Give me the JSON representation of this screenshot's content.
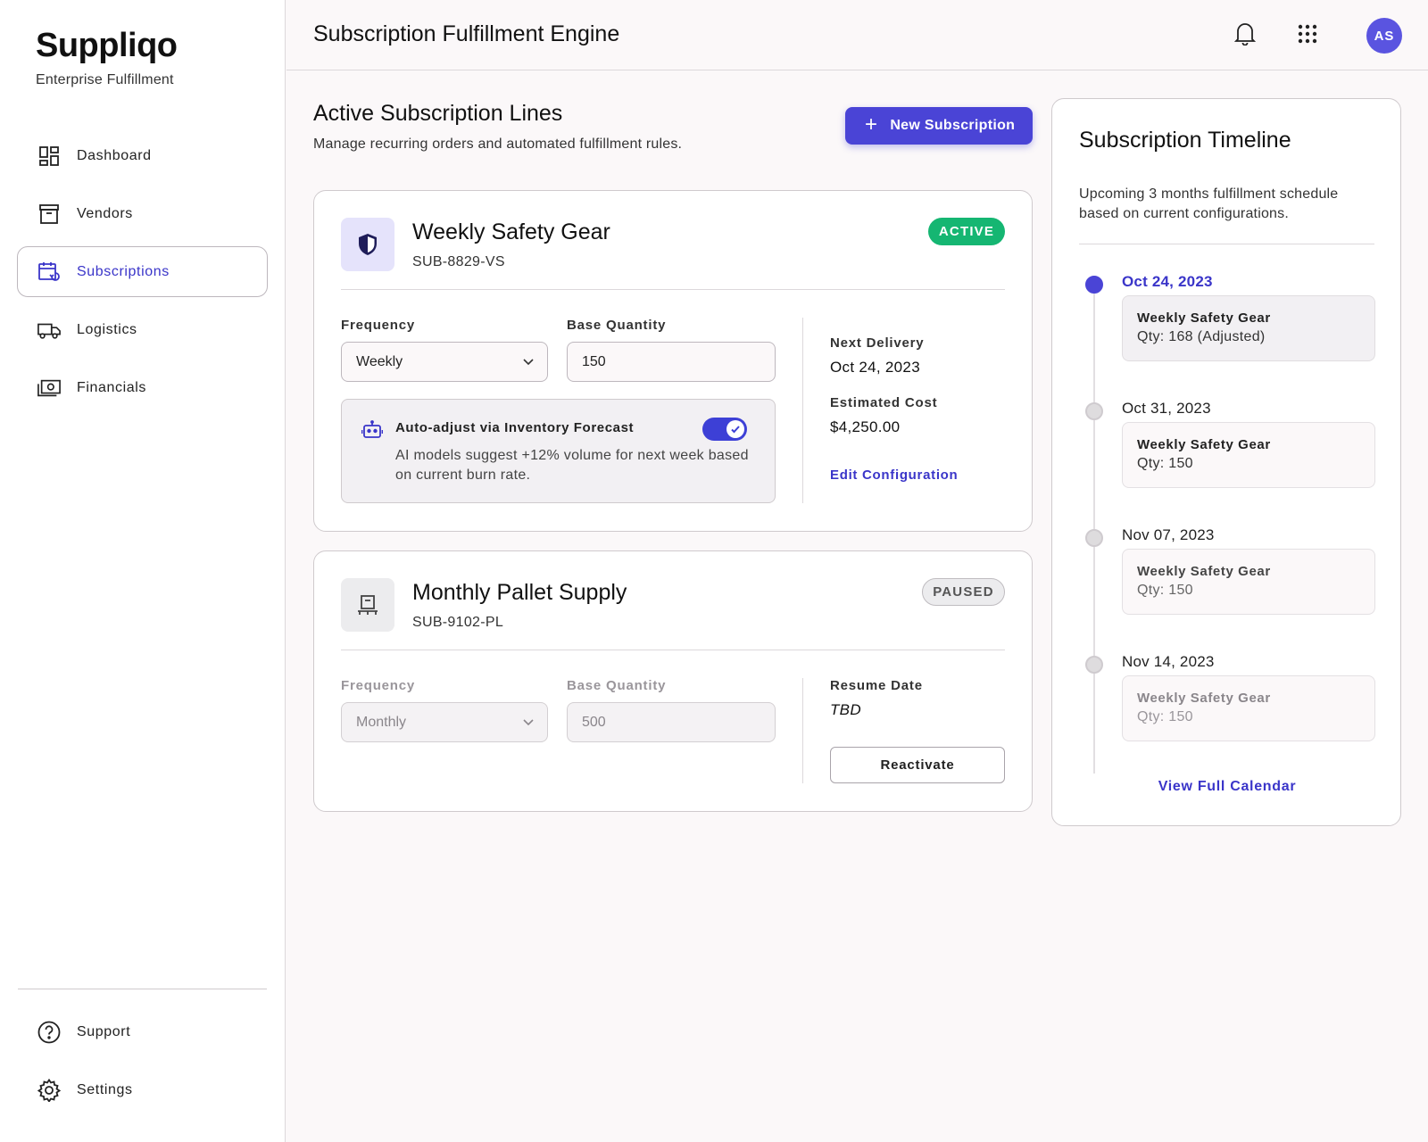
{
  "brand": {
    "name": "Suppliqo",
    "subtitle": "Enterprise Fulfillment"
  },
  "sidebar": {
    "items": [
      {
        "label": "Dashboard",
        "icon": "dashboard-icon"
      },
      {
        "label": "Vendors",
        "icon": "archive-icon"
      },
      {
        "label": "Subscriptions",
        "icon": "calendar-repeat-icon",
        "active": true
      },
      {
        "label": "Logistics",
        "icon": "truck-icon"
      },
      {
        "label": "Financials",
        "icon": "money-icon"
      }
    ],
    "bottom": [
      {
        "label": "Support",
        "icon": "help-icon"
      },
      {
        "label": "Settings",
        "icon": "gear-icon"
      }
    ]
  },
  "header": {
    "title": "Subscription Fulfillment Engine",
    "avatar_initials": "AS",
    "icons": [
      "bell-icon",
      "apps-grid-icon"
    ]
  },
  "section": {
    "title": "Active Subscription Lines",
    "subtitle": "Manage recurring orders and automated fulfillment rules.",
    "new_button": "New Subscription"
  },
  "cards": [
    {
      "title": "Weekly Safety Gear",
      "id": "SUB-8829-VS",
      "status": "ACTIVE",
      "icon": "shield-icon",
      "frequency_label": "Frequency",
      "frequency": "Weekly",
      "quantity_label": "Base Quantity",
      "quantity": "150",
      "ai_title": "Auto-adjust via Inventory Forecast",
      "ai_text": "AI models suggest +12% volume for next week based on current burn rate.",
      "ai_enabled": true,
      "next_delivery_label": "Next Delivery",
      "next_delivery": "Oct 24, 2023",
      "cost_label": "Estimated Cost",
      "cost": "$4,250.00",
      "action": "Edit Configuration"
    },
    {
      "title": "Monthly Pallet Supply",
      "id": "SUB-9102-PL",
      "status": "PAUSED",
      "icon": "pallet-icon",
      "frequency_label": "Frequency",
      "frequency": "Monthly",
      "quantity_label": "Base Quantity",
      "quantity": "500",
      "resume_label": "Resume Date",
      "resume": "TBD",
      "action": "Reactivate"
    }
  ],
  "timeline": {
    "title": "Subscription Timeline",
    "subtitle": "Upcoming 3 months fulfillment schedule based on current configurations.",
    "events": [
      {
        "date": "Oct 24, 2023",
        "name": "Weekly Safety Gear",
        "qty": "Qty: 168 (Adjusted)",
        "current": true
      },
      {
        "date": "Oct 31, 2023",
        "name": "Weekly Safety Gear",
        "qty": "Qty: 150"
      },
      {
        "date": "Nov 07, 2023",
        "name": "Weekly Safety Gear",
        "qty": "Qty: 150"
      },
      {
        "date": "Nov 14, 2023",
        "name": "Weekly Safety Gear",
        "qty": "Qty: 150"
      }
    ],
    "link": "View Full Calendar"
  },
  "colors": {
    "accent": "#4a44d6",
    "active": "#15b672",
    "link": "#3a35c9"
  }
}
